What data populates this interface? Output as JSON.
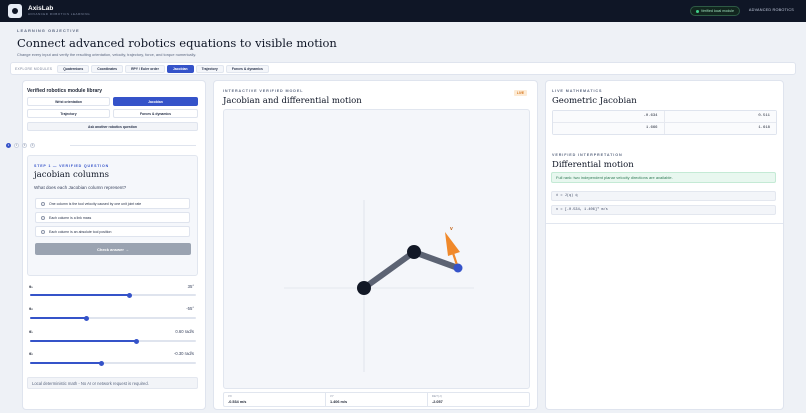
{
  "topbar": {
    "brand_name": "AxisLab",
    "brand_sub": "ADVANCED ROBOTICS LEARNING",
    "verified_label": "Verified local module",
    "mode_label": "ADVANCED ROBOTICS"
  },
  "hero": {
    "eyebrow": "LEARNING OBJECTIVE",
    "title": "Connect advanced robotics equations to visible motion",
    "subtitle": "Change every input and verify the resulting orientation, velocity, trajectory, force, and torque numerically."
  },
  "modules": {
    "label": "EXPLORE MODULES",
    "items": [
      "Quaternions",
      "Coordinates",
      "RPY / Euler order",
      "Jacobian",
      "Trajectory",
      "Forces & dynamics"
    ],
    "active_index": 3
  },
  "left": {
    "title": "Verified robotics module library",
    "segments": [
      "Wrist orientation",
      "Jacobian",
      "Trajectory",
      "Forces & dynamics"
    ],
    "ask_button": "Ask another robotics question",
    "steps": [
      "1",
      "2",
      "3",
      "4"
    ],
    "question": {
      "eyebrow": "STEP 1 — VERIFIED QUESTION",
      "title": "jacobian columns",
      "text": "What does each Jacobian column represent?",
      "options": [
        "One column is the tool velocity caused by one unit joint rate",
        "Each column is a link mass",
        "Each column is an absolute tool position"
      ],
      "check_button": "Check answer →"
    },
    "sliders": [
      {
        "label": "θ₁",
        "value": "35°",
        "fraction": 0.6
      },
      {
        "label": "θ₂",
        "value": "-55°",
        "fraction": 0.34
      },
      {
        "label": "θ̇₁",
        "value": "0.60 rad/s",
        "fraction": 0.64
      },
      {
        "label": "θ̇₂",
        "value": "-0.30 rad/s",
        "fraction": 0.43
      }
    ],
    "footer": "Local deterministic math - No AI or network request is required."
  },
  "middle": {
    "eyebrow": "INTERACTIVE VERIFIED MODEL",
    "title": "Jacobian and differential motion",
    "badge": "LIVE",
    "vector_label": "v",
    "metrics": [
      {
        "label": "VX",
        "value": "-0.534 m/s"
      },
      {
        "label": "VY",
        "value": "1.406 m/s"
      },
      {
        "label": "DET(J)",
        "value": "-2.057"
      }
    ]
  },
  "right": {
    "eyebrow": "LIVE MATHEMATICS",
    "title": "Geometric Jacobian",
    "matrix": [
      "-0.634",
      "0.511",
      "1.666",
      "1.618"
    ],
    "interp_eyebrow": "VERIFIED INTERPRETATION",
    "interp_title": "Differential motion",
    "rank_note": "Full rank: two independent planar velocity directions are available.",
    "formula_1": "ẋ = J(q) q̇",
    "formula_2": "v = [-0.534, 1.406]ᵀ m/s"
  },
  "colors": {
    "accent": "#3553c9",
    "link": "#5c6373",
    "joint": "#121826",
    "velocity": "#f0892b",
    "topbar": "#0f1626"
  }
}
